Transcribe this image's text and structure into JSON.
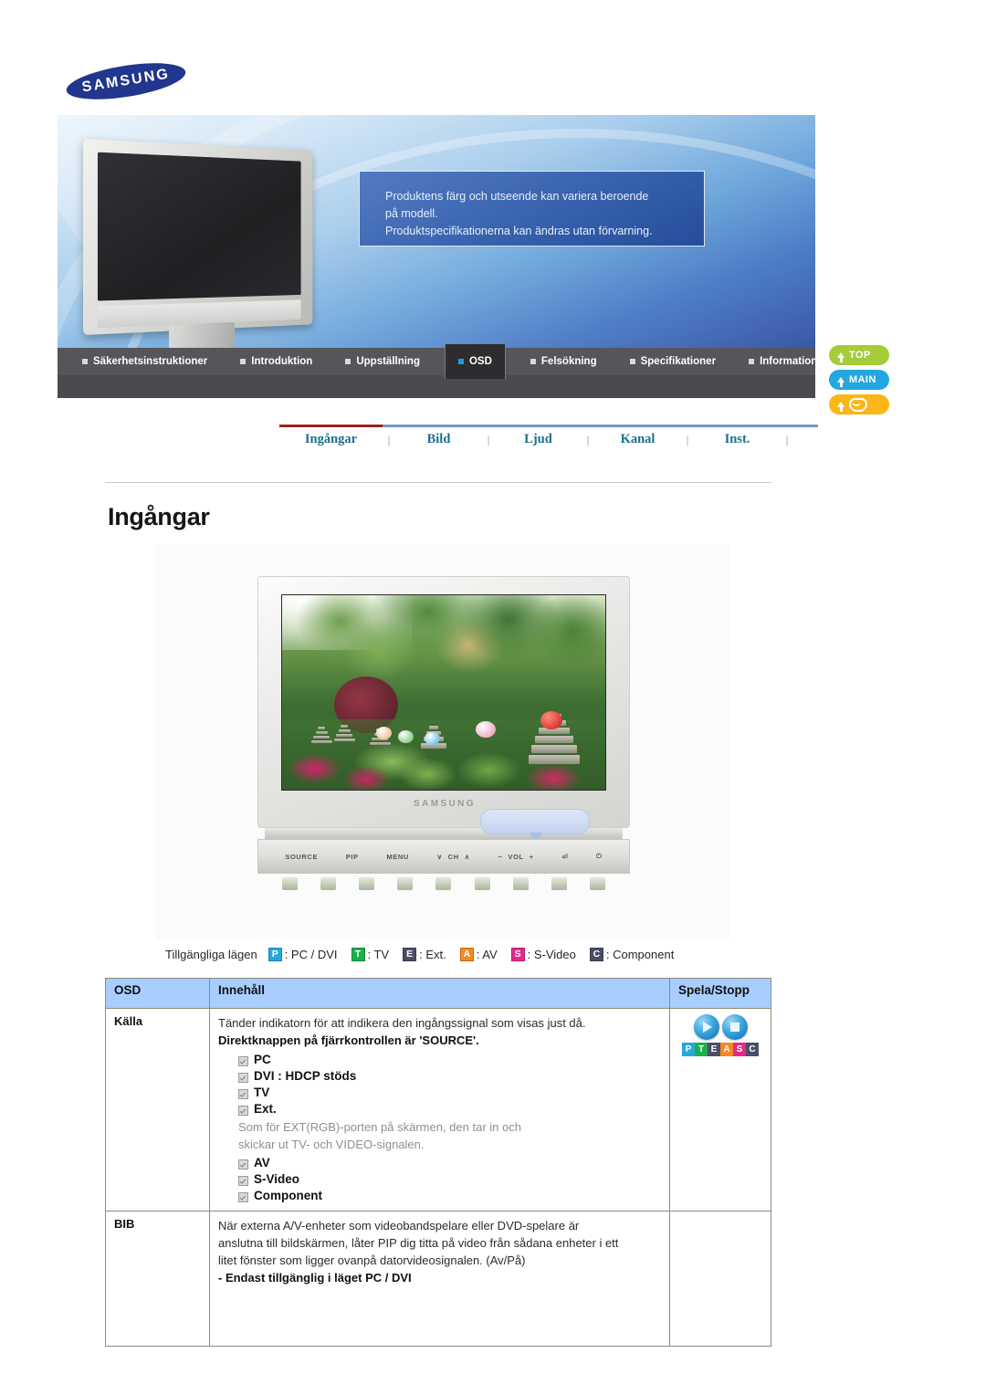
{
  "brand": {
    "logo_text": "SAMSUNG"
  },
  "hero": {
    "notice_line1": "Produktens färg och utseende kan variera beroende",
    "notice_line2": "på modell.",
    "notice_line3": "Produktspecifikationerna kan ändras utan förvarning."
  },
  "main_nav": {
    "items": [
      {
        "label": "Säkerhetsinstruktioner",
        "active": false
      },
      {
        "label": "Introduktion",
        "active": false
      },
      {
        "label": "Uppställning",
        "active": false
      },
      {
        "label": "OSD",
        "active": true
      },
      {
        "label": "Felsökning",
        "active": false
      },
      {
        "label": "Specifikationer",
        "active": false
      },
      {
        "label": "Information",
        "active": false
      }
    ]
  },
  "side_buttons": [
    {
      "label": "TOP",
      "icon": "arrow-up-icon",
      "color": "#a5cc39"
    },
    {
      "label": "MAIN",
      "icon": "arrow-turn-up-icon",
      "color": "#22a7e0"
    },
    {
      "label": "",
      "icon": "mail-icon",
      "color": "#fbb617"
    }
  ],
  "sub_tabs": {
    "items": [
      {
        "label": "Ingångar",
        "active": true
      },
      {
        "label": "Bild",
        "active": false
      },
      {
        "label": "Ljud",
        "active": false
      },
      {
        "label": "Kanal",
        "active": false
      },
      {
        "label": "Inst.",
        "active": false
      }
    ],
    "separator": "|",
    "accent_color": "#9e2119"
  },
  "page_title": "Ingångar",
  "figure": {
    "brand_on_tv": "SAMSUNG",
    "controls": [
      "SOURCE",
      "PIP",
      "MENU",
      "CH",
      "VOL",
      "enter-icon",
      "power-icon"
    ],
    "control_ch_down": "∨",
    "control_ch_up": "∧",
    "control_vol_minus": "−",
    "control_vol_plus": "+"
  },
  "modes_legend": {
    "lead": "Tillgängliga lägen",
    "items": [
      {
        "badge": "P",
        "color": "#27a8dc",
        "text": ": PC / DVI"
      },
      {
        "badge": "T",
        "color": "#19b04e",
        "text": ": TV"
      },
      {
        "badge": "E",
        "color": "#4a4e66",
        "text": ": Ext."
      },
      {
        "badge": "A",
        "color": "#f5881f",
        "text": ": AV"
      },
      {
        "badge": "S",
        "color": "#e32a8c",
        "text": ": S-Video"
      },
      {
        "badge": "C",
        "color": "#4a4e66",
        "text": ": Component"
      }
    ]
  },
  "table": {
    "headers": {
      "osd": "OSD",
      "content": "Innehåll",
      "play": "Spela/Stopp"
    },
    "rows": [
      {
        "osd": "Källa",
        "intro": "Tänder indikatorn för att indikera den ingångssignal som visas just då.",
        "bold_line": "Direktknappen på fjärrkontrollen är 'SOURCE'.",
        "bullets_before": [
          "PC",
          "DVI : HDCP stöds",
          "TV",
          "Ext."
        ],
        "gray_note_line1": "Som för EXT(RGB)-porten på skärmen, den tar in och",
        "gray_note_line2": "skickar ut TV- och VIDEO-signalen.",
        "bullets_after": [
          "AV",
          "S-Video",
          "Component"
        ],
        "play_badges": [
          {
            "letter": "P",
            "color": "#27a8dc"
          },
          {
            "letter": "T",
            "color": "#19b04e"
          },
          {
            "letter": "E",
            "color": "#4a4e66"
          },
          {
            "letter": "A",
            "color": "#f5881f"
          },
          {
            "letter": "S",
            "color": "#e32a8c"
          },
          {
            "letter": "C",
            "color": "#4a4e66"
          }
        ]
      },
      {
        "osd": "BIB",
        "line1": "När externa A/V-enheter som videobandspelare eller DVD-spelare är",
        "line2": "anslutna till bildskärmen, låter PIP dig titta på video från sådana enheter i ett",
        "line3": "litet fönster som ligger ovanpå datorvideosignalen. (Av/På)",
        "bold_line": "- Endast tillgänglig i läget PC / DVI"
      }
    ]
  }
}
